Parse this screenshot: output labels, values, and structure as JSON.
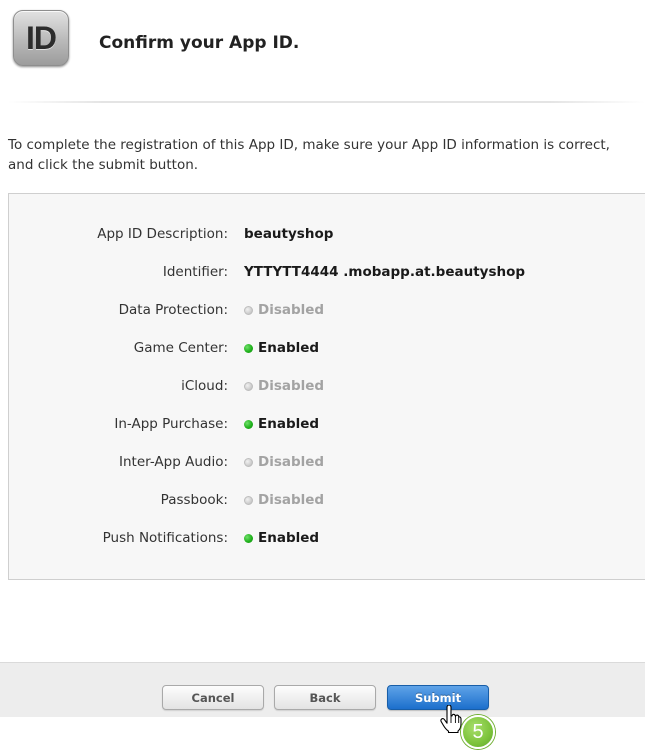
{
  "header": {
    "icon_text": "ID",
    "title": "Confirm your App ID."
  },
  "intro_text": "To complete the registration of this App ID, make sure your App ID information is correct, and click the submit button.",
  "details": [
    {
      "label": "App ID Description:",
      "value": "beautyshop",
      "status": null
    },
    {
      "label": "Identifier:",
      "value": "YTTYTT4444 .mobapp.at.beautyshop",
      "status": null
    },
    {
      "label": "Data Protection:",
      "value": "Disabled",
      "status": "disabled"
    },
    {
      "label": "Game Center:",
      "value": "Enabled",
      "status": "enabled"
    },
    {
      "label": "iCloud:",
      "value": "Disabled",
      "status": "disabled"
    },
    {
      "label": "In-App Purchase:",
      "value": "Enabled",
      "status": "enabled"
    },
    {
      "label": "Inter-App Audio:",
      "value": "Disabled",
      "status": "disabled"
    },
    {
      "label": "Passbook:",
      "value": "Disabled",
      "status": "disabled"
    },
    {
      "label": "Push Notifications:",
      "value": "Enabled",
      "status": "enabled"
    }
  ],
  "buttons": {
    "cancel": "Cancel",
    "back": "Back",
    "submit": "Submit"
  },
  "step_badge": "5",
  "colors": {
    "enabled": "#21b21d",
    "disabled": "#a3a3a3",
    "submit": "#1c6fcc",
    "badge": "#7cc33b"
  }
}
